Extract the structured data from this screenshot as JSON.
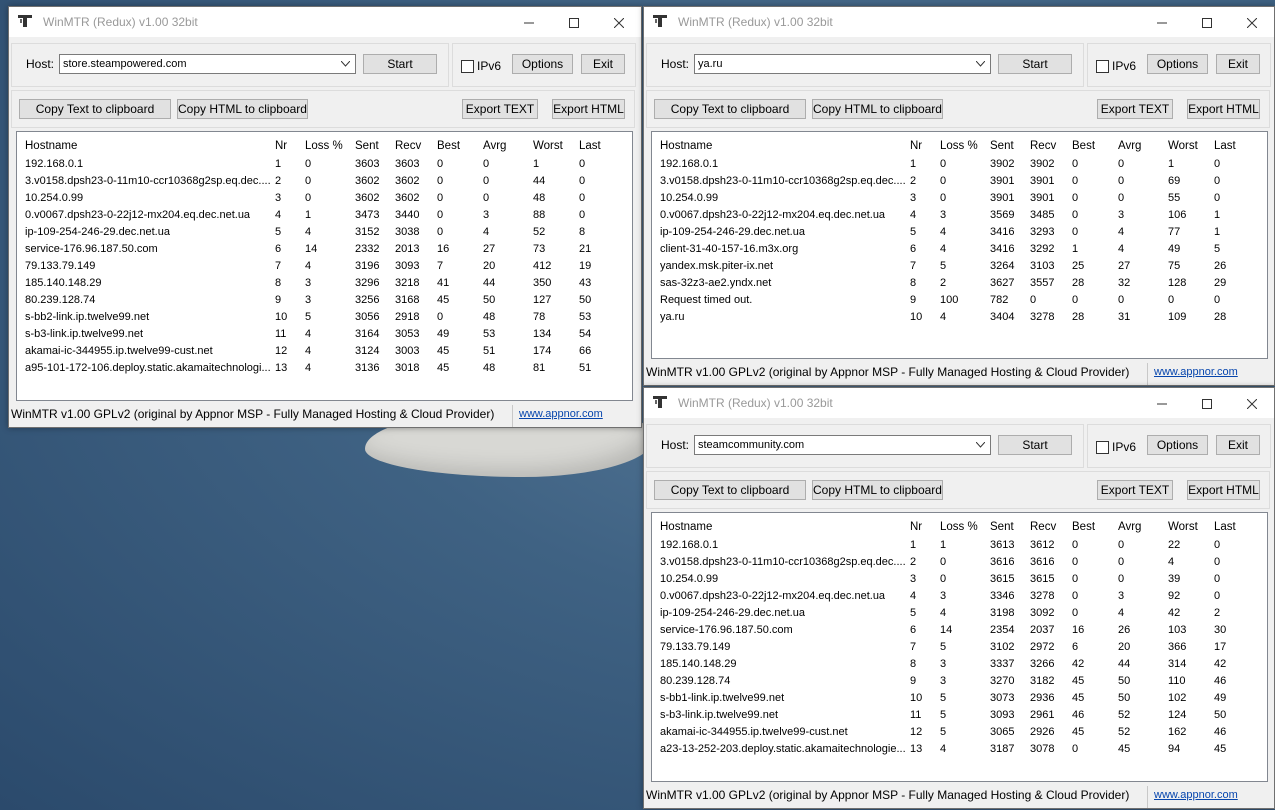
{
  "columns": [
    "Hostname",
    "Nr",
    "Loss %",
    "Sent",
    "Recv",
    "Best",
    "Avrg",
    "Worst",
    "Last"
  ],
  "win1": {
    "title": "WinMTR (Redux) v1.00 32bit",
    "host_label": "Host:",
    "host_value": "store.steampowered.com",
    "start": "Start",
    "ipv6": "IPv6",
    "options": "Options",
    "exit": "Exit",
    "copy_text": "Copy Text to clipboard",
    "copy_html": "Copy HTML to clipboard",
    "export_text": "Export TEXT",
    "export_html": "Export HTML",
    "status": "WinMTR v1.00 GPLv2 (original by Appnor MSP - Fully Managed Hosting & Cloud Provider)",
    "link": "www.appnor.com",
    "rows": [
      [
        "192.168.0.1",
        "1",
        "0",
        "3603",
        "3603",
        "0",
        "0",
        "1",
        "0"
      ],
      [
        "3.v0158.dpsh23-0-11m10-ccr10368g2sp.eq.dec....",
        "2",
        "0",
        "3602",
        "3602",
        "0",
        "0",
        "44",
        "0"
      ],
      [
        "10.254.0.99",
        "3",
        "0",
        "3602",
        "3602",
        "0",
        "0",
        "48",
        "0"
      ],
      [
        "0.v0067.dpsh23-0-22j12-mx204.eq.dec.net.ua",
        "4",
        "1",
        "3473",
        "3440",
        "0",
        "3",
        "88",
        "0"
      ],
      [
        "ip-109-254-246-29.dec.net.ua",
        "5",
        "4",
        "3152",
        "3038",
        "0",
        "4",
        "52",
        "8"
      ],
      [
        "service-176.96.187.50.com",
        "6",
        "14",
        "2332",
        "2013",
        "16",
        "27",
        "73",
        "21"
      ],
      [
        "79.133.79.149",
        "7",
        "4",
        "3196",
        "3093",
        "7",
        "20",
        "412",
        "19"
      ],
      [
        "185.140.148.29",
        "8",
        "3",
        "3296",
        "3218",
        "41",
        "44",
        "350",
        "43"
      ],
      [
        "80.239.128.74",
        "9",
        "3",
        "3256",
        "3168",
        "45",
        "50",
        "127",
        "50"
      ],
      [
        "s-bb2-link.ip.twelve99.net",
        "10",
        "5",
        "3056",
        "2918",
        "0",
        "48",
        "78",
        "53"
      ],
      [
        "s-b3-link.ip.twelve99.net",
        "11",
        "4",
        "3164",
        "3053",
        "49",
        "53",
        "134",
        "54"
      ],
      [
        "akamai-ic-344955.ip.twelve99-cust.net",
        "12",
        "4",
        "3124",
        "3003",
        "45",
        "51",
        "174",
        "66"
      ],
      [
        "a95-101-172-106.deploy.static.akamaitechnologi...",
        "13",
        "4",
        "3136",
        "3018",
        "45",
        "48",
        "81",
        "51"
      ]
    ]
  },
  "win2": {
    "title": "WinMTR (Redux) v1.00 32bit",
    "host_label": "Host:",
    "host_value": "ya.ru",
    "start": "Start",
    "ipv6": "IPv6",
    "options": "Options",
    "exit": "Exit",
    "copy_text": "Copy Text to clipboard",
    "copy_html": "Copy HTML to clipboard",
    "export_text": "Export TEXT",
    "export_html": "Export HTML",
    "status": "WinMTR v1.00 GPLv2 (original by Appnor MSP - Fully Managed Hosting & Cloud Provider)",
    "link": "www.appnor.com",
    "rows": [
      [
        "192.168.0.1",
        "1",
        "0",
        "3902",
        "3902",
        "0",
        "0",
        "1",
        "0"
      ],
      [
        "3.v0158.dpsh23-0-11m10-ccr10368g2sp.eq.dec....",
        "2",
        "0",
        "3901",
        "3901",
        "0",
        "0",
        "69",
        "0"
      ],
      [
        "10.254.0.99",
        "3",
        "0",
        "3901",
        "3901",
        "0",
        "0",
        "55",
        "0"
      ],
      [
        "0.v0067.dpsh23-0-22j12-mx204.eq.dec.net.ua",
        "4",
        "3",
        "3569",
        "3485",
        "0",
        "3",
        "106",
        "1"
      ],
      [
        "ip-109-254-246-29.dec.net.ua",
        "5",
        "4",
        "3416",
        "3293",
        "0",
        "4",
        "77",
        "1"
      ],
      [
        "client-31-40-157-16.m3x.org",
        "6",
        "4",
        "3416",
        "3292",
        "1",
        "4",
        "49",
        "5"
      ],
      [
        "yandex.msk.piter-ix.net",
        "7",
        "5",
        "3264",
        "3103",
        "25",
        "27",
        "75",
        "26"
      ],
      [
        "sas-32z3-ae2.yndx.net",
        "8",
        "2",
        "3627",
        "3557",
        "28",
        "32",
        "128",
        "29"
      ],
      [
        "Request timed out.",
        "9",
        "100",
        "782",
        "0",
        "0",
        "0",
        "0",
        "0"
      ],
      [
        "ya.ru",
        "10",
        "4",
        "3404",
        "3278",
        "28",
        "31",
        "109",
        "28"
      ]
    ]
  },
  "win3": {
    "title": "WinMTR (Redux) v1.00 32bit",
    "host_label": "Host:",
    "host_value": "steamcommunity.com",
    "start": "Start",
    "ipv6": "IPv6",
    "options": "Options",
    "exit": "Exit",
    "copy_text": "Copy Text to clipboard",
    "copy_html": "Copy HTML to clipboard",
    "export_text": "Export TEXT",
    "export_html": "Export HTML",
    "status": "WinMTR v1.00 GPLv2 (original by Appnor MSP - Fully Managed Hosting & Cloud Provider)",
    "link": "www.appnor.com",
    "rows": [
      [
        "192.168.0.1",
        "1",
        "1",
        "3613",
        "3612",
        "0",
        "0",
        "22",
        "0"
      ],
      [
        "3.v0158.dpsh23-0-11m10-ccr10368g2sp.eq.dec....",
        "2",
        "0",
        "3616",
        "3616",
        "0",
        "0",
        "4",
        "0"
      ],
      [
        "10.254.0.99",
        "3",
        "0",
        "3615",
        "3615",
        "0",
        "0",
        "39",
        "0"
      ],
      [
        "0.v0067.dpsh23-0-22j12-mx204.eq.dec.net.ua",
        "4",
        "3",
        "3346",
        "3278",
        "0",
        "3",
        "92",
        "0"
      ],
      [
        "ip-109-254-246-29.dec.net.ua",
        "5",
        "4",
        "3198",
        "3092",
        "0",
        "4",
        "42",
        "2"
      ],
      [
        "service-176.96.187.50.com",
        "6",
        "14",
        "2354",
        "2037",
        "16",
        "26",
        "103",
        "30"
      ],
      [
        "79.133.79.149",
        "7",
        "5",
        "3102",
        "2972",
        "6",
        "20",
        "366",
        "17"
      ],
      [
        "185.140.148.29",
        "8",
        "3",
        "3337",
        "3266",
        "42",
        "44",
        "314",
        "42"
      ],
      [
        "80.239.128.74",
        "9",
        "3",
        "3270",
        "3182",
        "45",
        "50",
        "110",
        "46"
      ],
      [
        "s-bb1-link.ip.twelve99.net",
        "10",
        "5",
        "3073",
        "2936",
        "45",
        "50",
        "102",
        "49"
      ],
      [
        "s-b3-link.ip.twelve99.net",
        "11",
        "5",
        "3093",
        "2961",
        "46",
        "52",
        "124",
        "50"
      ],
      [
        "akamai-ic-344955.ip.twelve99-cust.net",
        "12",
        "5",
        "3065",
        "2926",
        "45",
        "52",
        "162",
        "46"
      ],
      [
        "a23-13-252-203.deploy.static.akamaitechnologie...",
        "13",
        "4",
        "3187",
        "3078",
        "0",
        "45",
        "94",
        "45"
      ]
    ]
  }
}
